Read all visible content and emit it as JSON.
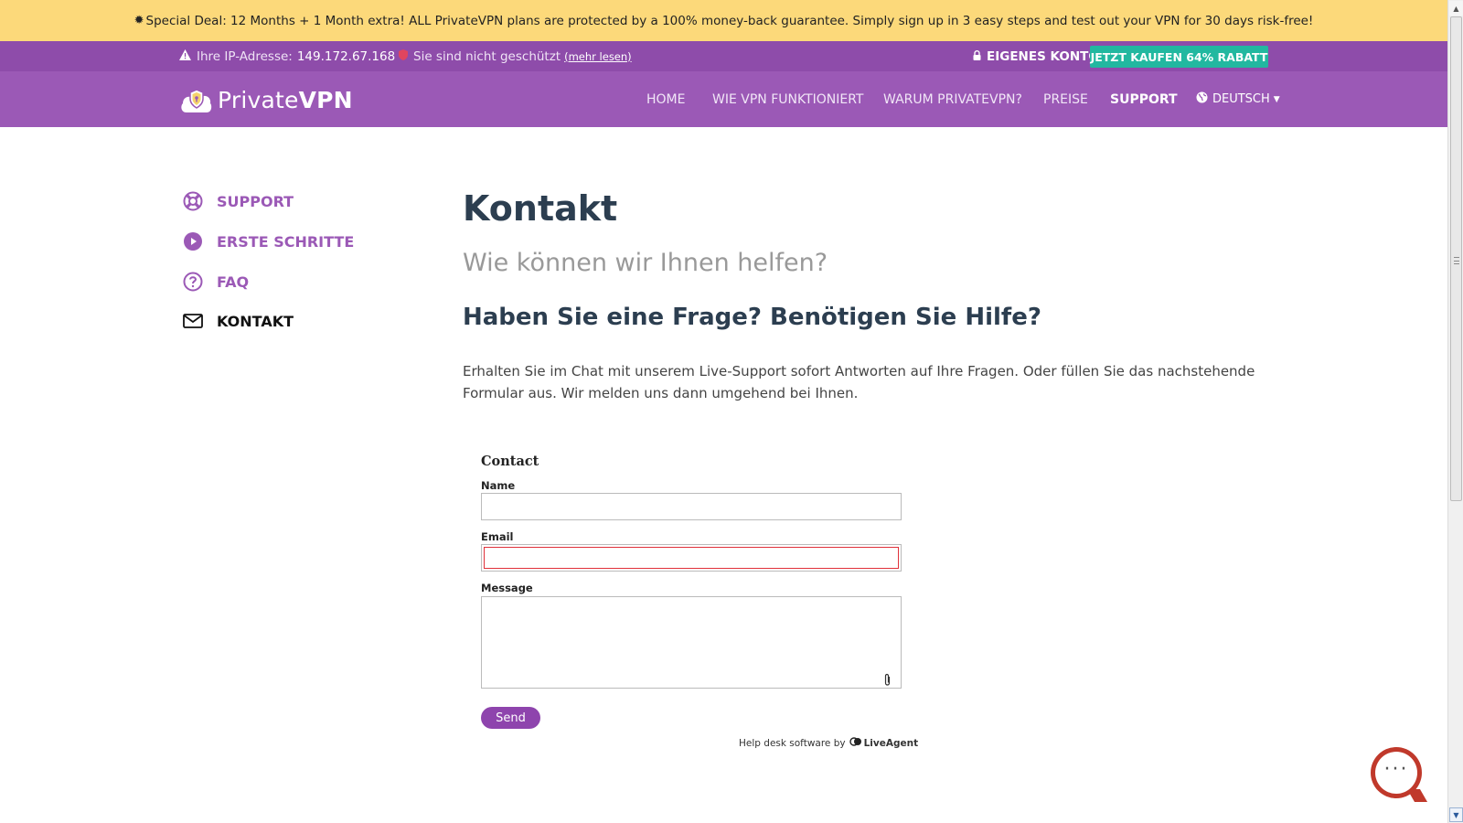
{
  "promo": {
    "text": "Special Deal: 12 Months + 1 Month extra! ALL PrivateVPN plans are protected by a 100% money-back guarantee. Simply sign up in 3 easy steps and test out your VPN for 30 days risk-free!"
  },
  "infobar": {
    "ip_label": "Ihre IP-Adresse:",
    "ip_value": "149.172.67.168",
    "protection_text": "Sie sind nicht geschützt",
    "read_more": "(mehr lesen)",
    "account_label": "EIGENES KONTO",
    "buy_label": "JETZT KAUFEN 64% RABATT"
  },
  "brand": {
    "name_light": "Private",
    "name_bold": "VPN"
  },
  "nav": {
    "items": [
      "HOME",
      "WIE VPN FUNKTIONIERT",
      "WARUM PRIVATEVPN?",
      "PREISE",
      "SUPPORT"
    ],
    "language": "DEUTSCH"
  },
  "sidebar": {
    "items": [
      {
        "label": "SUPPORT",
        "icon": "lifebuoy-icon"
      },
      {
        "label": "ERSTE SCHRITTE",
        "icon": "play-circle-icon"
      },
      {
        "label": "FAQ",
        "icon": "question-circle-icon"
      },
      {
        "label": "KONTAKT",
        "icon": "envelope-icon"
      }
    ]
  },
  "main": {
    "title": "Kontakt",
    "subtitle": "Wie können wir Ihnen helfen?",
    "heading": "Haben Sie eine Frage? Benötigen Sie Hilfe?",
    "paragraph": "Erhalten Sie im Chat mit unserem Live-Support sofort Antworten auf Ihre Fragen. Oder füllen Sie das nachstehende Formular aus. Wir melden uns dann umgehend bei Ihnen."
  },
  "form": {
    "title": "Contact",
    "name_label": "Name",
    "name_value": "",
    "email_label": "Email",
    "email_value": "",
    "message_label": "Message",
    "message_value": "",
    "send_label": "Send",
    "powered_prefix": "Help desk software by",
    "powered_brand": "LiveAgent"
  },
  "colors": {
    "promo_bg": "#fcd97a",
    "infobar_bg": "#8e4caa",
    "navbar_bg": "#9b59b6",
    "accent": "#9b59b6",
    "buy_button": "#22b8a0",
    "error": "#e0313a",
    "chat": "#c0392b"
  }
}
